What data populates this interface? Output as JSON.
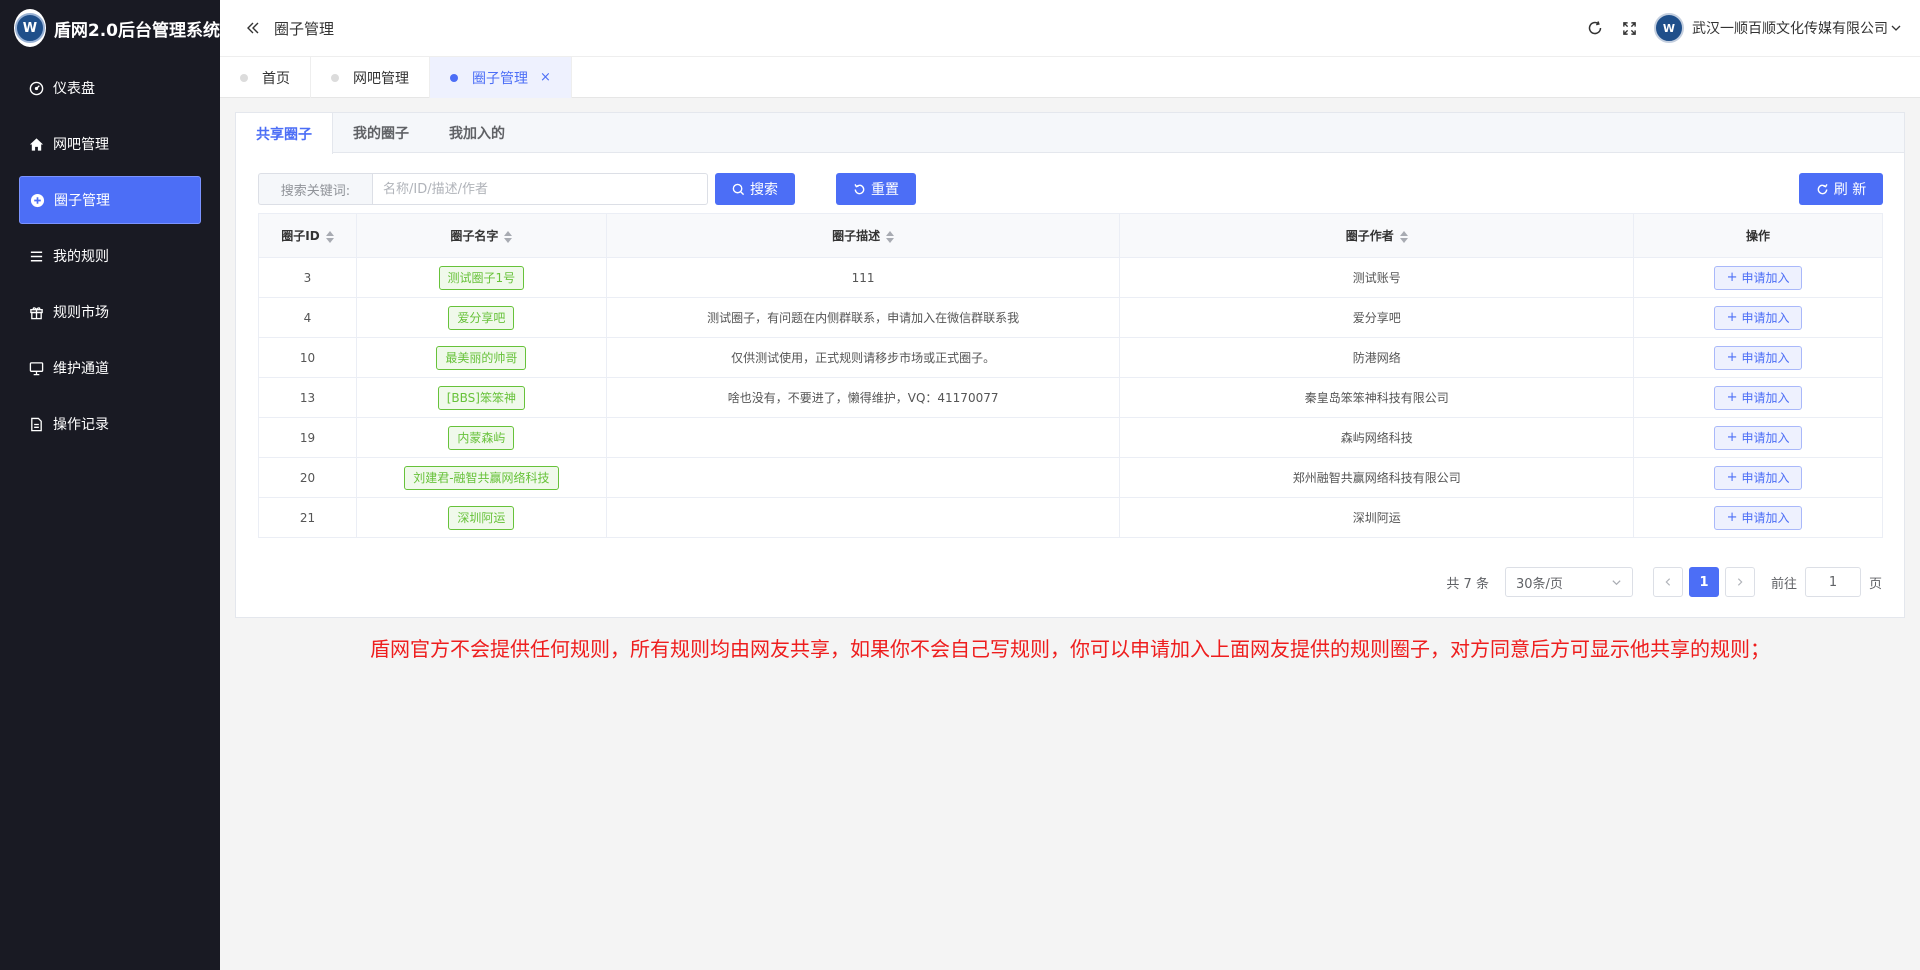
{
  "app": {
    "title": "盾网2.0后台管理系统",
    "logo_icon": "shield-w-logo"
  },
  "sidebar": {
    "items": [
      {
        "label": "仪表盘",
        "icon": "gauge-icon",
        "active": false
      },
      {
        "label": "网吧管理",
        "icon": "home-icon",
        "active": false
      },
      {
        "label": "圈子管理",
        "icon": "circle-plus-icon",
        "active": true
      },
      {
        "label": "我的规则",
        "icon": "list-icon",
        "active": false
      },
      {
        "label": "规则市场",
        "icon": "gift-icon",
        "active": false
      },
      {
        "label": "维护通道",
        "icon": "monitor-icon",
        "active": false
      },
      {
        "label": "操作记录",
        "icon": "document-icon",
        "active": false
      }
    ]
  },
  "header": {
    "title": "圈子管理",
    "company": "武汉一顺百顺文化传媒有限公司"
  },
  "tabs": [
    {
      "label": "首页",
      "active": false
    },
    {
      "label": "网吧管理",
      "active": false
    },
    {
      "label": "圈子管理",
      "active": true,
      "close": "×"
    }
  ],
  "subtabs": [
    {
      "label": "共享圈子",
      "active": true
    },
    {
      "label": "我的圈子",
      "active": false
    },
    {
      "label": "我加入的",
      "active": false
    }
  ],
  "search": {
    "label": "搜索关键词:",
    "placeholder": "名称/ID/描述/作者",
    "search_button": "搜索",
    "reset_button": "重置",
    "refresh_button": "刷 新"
  },
  "table": {
    "columns": [
      "圈子ID",
      "圈子名字",
      "圈子描述",
      "圈子作者",
      "操作"
    ],
    "action_label": "申请加入",
    "rows": [
      {
        "id": "3",
        "name": "测试圈子1号",
        "desc": "111",
        "author": "测试账号"
      },
      {
        "id": "4",
        "name": "爱分享吧",
        "desc": "测试圈子，有问题在内侧群联系，申请加入在微信群联系我",
        "author": "爱分享吧"
      },
      {
        "id": "10",
        "name": "最美丽的帅哥",
        "desc": "仅供测试使用，正式规则请移步市场或正式圈子。",
        "author": "防港网络"
      },
      {
        "id": "13",
        "name": "[BBS]笨笨神",
        "desc": "啥也没有，不要进了，懒得维护，VQ：41170077",
        "author": "秦皇岛笨笨神科技有限公司"
      },
      {
        "id": "19",
        "name": "内蒙森屿",
        "desc": "",
        "author": "森屿网络科技"
      },
      {
        "id": "20",
        "name": "刘建君-融智共赢网络科技",
        "desc": "",
        "author": "郑州融智共赢网络科技有限公司"
      },
      {
        "id": "21",
        "name": "深圳阿运",
        "desc": "",
        "author": "深圳阿运"
      }
    ]
  },
  "pagination": {
    "total": "共 7 条",
    "page_size": "30条/页",
    "current_page": "1",
    "goto_label": "前往",
    "goto_value": "1",
    "page_suffix": "页"
  },
  "notice": "盾网官方不会提供任何规则，所有规则均由网友共享，如果你不会自己写规则，你可以申请加入上面网友提供的规则圈子，对方同意后方可显示他共享的规则；",
  "colors": {
    "primary": "#4c6ef6",
    "sidebar_bg": "#191a23",
    "tag_green": "#67c23a",
    "notice_red": "#ee1d1d"
  }
}
